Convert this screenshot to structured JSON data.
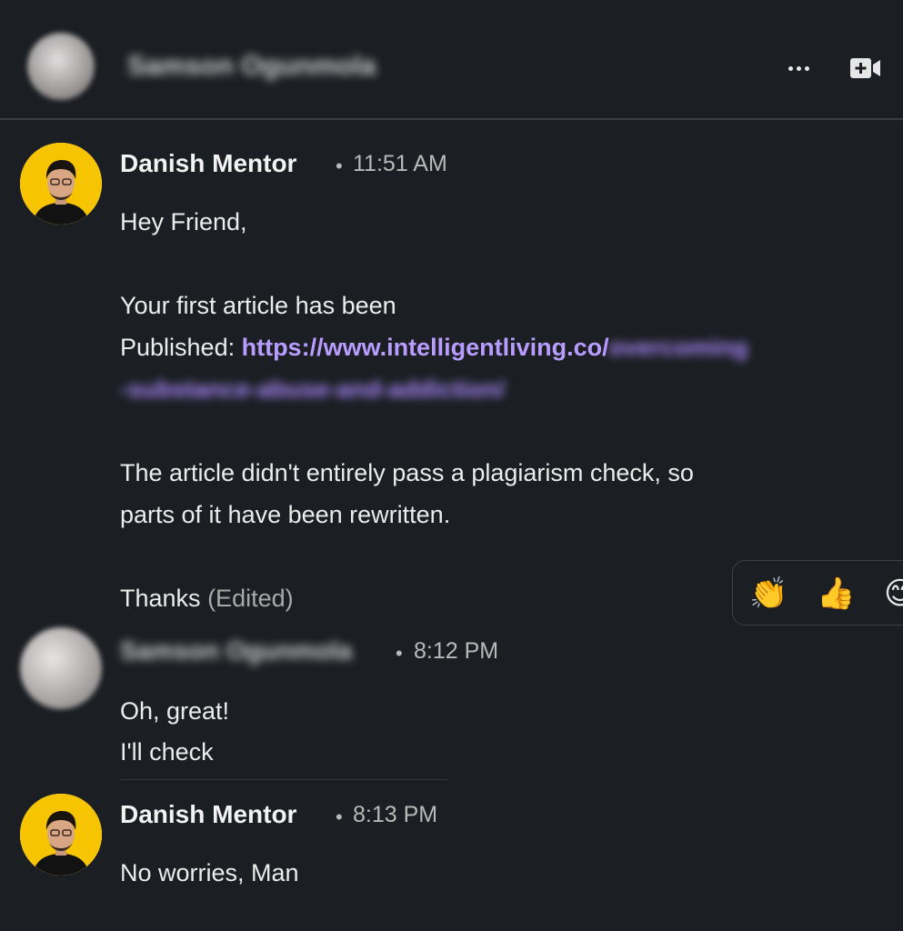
{
  "header": {
    "contact_name": "Samson Ogunmola",
    "more_icon": "more-horizontal-icon",
    "video_icon": "video-call-icon"
  },
  "messages": [
    {
      "sender": "Danish Mentor",
      "separator": "•",
      "time": "11:51 AM",
      "lines": [
        "Hey Friend,",
        "Your first article has been",
        "Published: ",
        "The article didn't entirely pass a plagiarism check, so",
        "parts of it have been rewritten.",
        "Thanks"
      ],
      "link_visible": "https://www.intelligentliving.co/",
      "link_hidden_1": "overcoming",
      "link_hidden_2": "-substance-abuse-and-addiction/",
      "edited": "(Edited)"
    },
    {
      "sender": "Samson Ogunmola",
      "separator": "•",
      "time": "8:12 PM",
      "lines": [
        "Oh, great!",
        "I'll check"
      ]
    },
    {
      "sender": "Danish Mentor",
      "separator": "•",
      "time": "8:13 PM",
      "lines": [
        "No worries, Man"
      ]
    }
  ],
  "reactions": [
    "👏",
    "👍",
    "😊"
  ],
  "colors": {
    "background": "#1b1e22",
    "link": "#b99cff",
    "avatar_bg": "#f6c400"
  }
}
